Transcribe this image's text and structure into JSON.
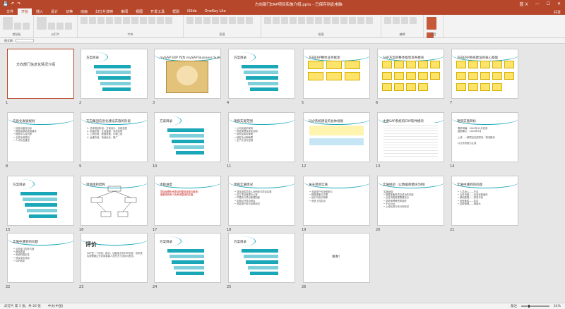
{
  "window": {
    "doc_title": "方向部门ERP项目实施介绍.pptx - 已保存到此电脑",
    "save_label": "💾",
    "undo_label": "↶",
    "redo_label": "↷",
    "user": "蓝 X",
    "minimize": "—",
    "maximize": "☐",
    "close": "✕"
  },
  "tabs": [
    "文件",
    "开始",
    "插入",
    "设计",
    "切换",
    "动画",
    "幻灯片放映",
    "审阅",
    "视图",
    "开发工具",
    "帮助",
    "iSlide",
    "OneKey Lite"
  ],
  "active_tab": 1,
  "share_label": "共享",
  "ribbon_groups": [
    "剪贴板",
    "幻灯片",
    "字体",
    "段落",
    "绘图",
    "编辑",
    "语音"
  ],
  "qat": {
    "format_painter_label": "格式刷"
  },
  "slides": [
    {
      "num": "1",
      "title": "方向部门信息化情况介绍",
      "style": "center"
    },
    {
      "num": "2",
      "title": "方案目录",
      "bars": [
        "",
        "",
        "",
        "",
        ""
      ]
    },
    {
      "num": "3",
      "title": "mySAP ERP 作为 mySAP Business Suite 的核心",
      "style": "image"
    },
    {
      "num": "4",
      "title": "方案目录",
      "bars": [
        "",
        "",
        "",
        "",
        ""
      ]
    },
    {
      "num": "5",
      "title": "方向ERP整体业务框架",
      "style": "flow"
    },
    {
      "num": "6",
      "title": "SAP方案的整体框架及各模块",
      "style": "flow"
    },
    {
      "num": "7",
      "title": "方向ERP系统建设的核心基础",
      "style": "flow"
    },
    {
      "num": "8",
      "title": "信息化发展规划",
      "text": "• 信息化建设目标\n• 网络及基础设施建设\n• 数据中心及机房\n• 业务系统规划\n• 人才队伍建设"
    },
    {
      "num": "9",
      "title": "方向集团信息化建设实施的阶段",
      "text": "1. 总体规划阶段：方案设计、系统选型\n2. 实施阶段：业务蓝图、系统实现\n3. 上线阶段：数据准备、切换上线\n4. 运维阶段：持续优化、推广"
    },
    {
      "num": "10",
      "title": "方案目录",
      "bars": [
        "",
        "",
        "",
        "",
        ""
      ]
    },
    {
      "num": "11",
      "title": "项目实施范围",
      "text": "• 公司及组织架构\n• 财务管理及成本控制\n• 采购及库存管理\n• 销售及分销管理\n• 生产计划与控制"
    },
    {
      "num": "12",
      "title": "SAP系统建设的总体规划",
      "style": "band"
    },
    {
      "num": "13",
      "title": "主要SAP系统的ERP软件模块",
      "style": "table"
    },
    {
      "num": "14",
      "title": "项目实施目标",
      "text": "需求明确：2001年12月完成\n蓝图确认：2002年3月\n\n上线：一期项目完成财务、物流模块\n\n以业务流程为主线"
    },
    {
      "num": "15",
      "title": "方案目录",
      "bars": [
        "",
        "",
        "",
        "",
        ""
      ]
    },
    {
      "num": "16",
      "title": "项目组织结构",
      "style": "org"
    },
    {
      "num": "17",
      "title": "项目进度",
      "text": "项目经理负责项目的整体协调与推进；\n各模块负责人负责本模块的实施。",
      "red": true
    },
    {
      "num": "18",
      "title": "项目实施情况",
      "text": "• 项目组成员投入全职参与项目实施\n• 成立项目管理办公室\n• 严格执行项目管理制度\n• 定期召开项目例会\n• 关键用户参与系统测试"
    },
    {
      "num": "19",
      "title": "关于项目实施",
      "text": "• 关键用户的全程参与\n• 数据准备与清理\n• 培训与知识转移\n• 系统上线支持"
    },
    {
      "num": "20",
      "title": "实施经验（以数据库模块为例）",
      "text": "实施经验：\n• 数据准备是项目成功的关键\n• 业务流程梳理需要充分\n• 变更管理需贯穿始终\n• Training\n• 上线前进行充分的测试"
    },
    {
      "num": "21",
      "title": "实施中遇到的问题",
      "text": "• 人员投入——不足\n• 业务流程——标准化程度低\n• 基础数据——质量不高\n• 系统集成——复杂\n• 变更管理——难度大"
    },
    {
      "num": "22",
      "title": "实施中遇到的问题",
      "text": "• 业务部门的参与度\n• 基础数据\n• 系统的稳定性\n• 项目成员流动\n• SAP培训"
    },
    {
      "num": "23",
      "title": "评价",
      "text": "SAP是一个成熟、稳定、功能强大的ERP系统，但系统实施需要企业内部各级人员的大力支持与配合。",
      "style": "eval"
    },
    {
      "num": "24",
      "title": "方案目录",
      "bars": [
        "",
        "",
        "",
        "",
        ""
      ]
    },
    {
      "num": "25",
      "title": "方案目录",
      "bars": [
        "",
        "",
        "",
        "",
        ""
      ]
    },
    {
      "num": "26",
      "title": "谢谢！",
      "style": "thanks"
    }
  ],
  "status": {
    "slide_info": "幻灯片 第 1 张，共 26 张",
    "language": "中文(中国)",
    "notes": "备注",
    "zoom": "24%"
  }
}
